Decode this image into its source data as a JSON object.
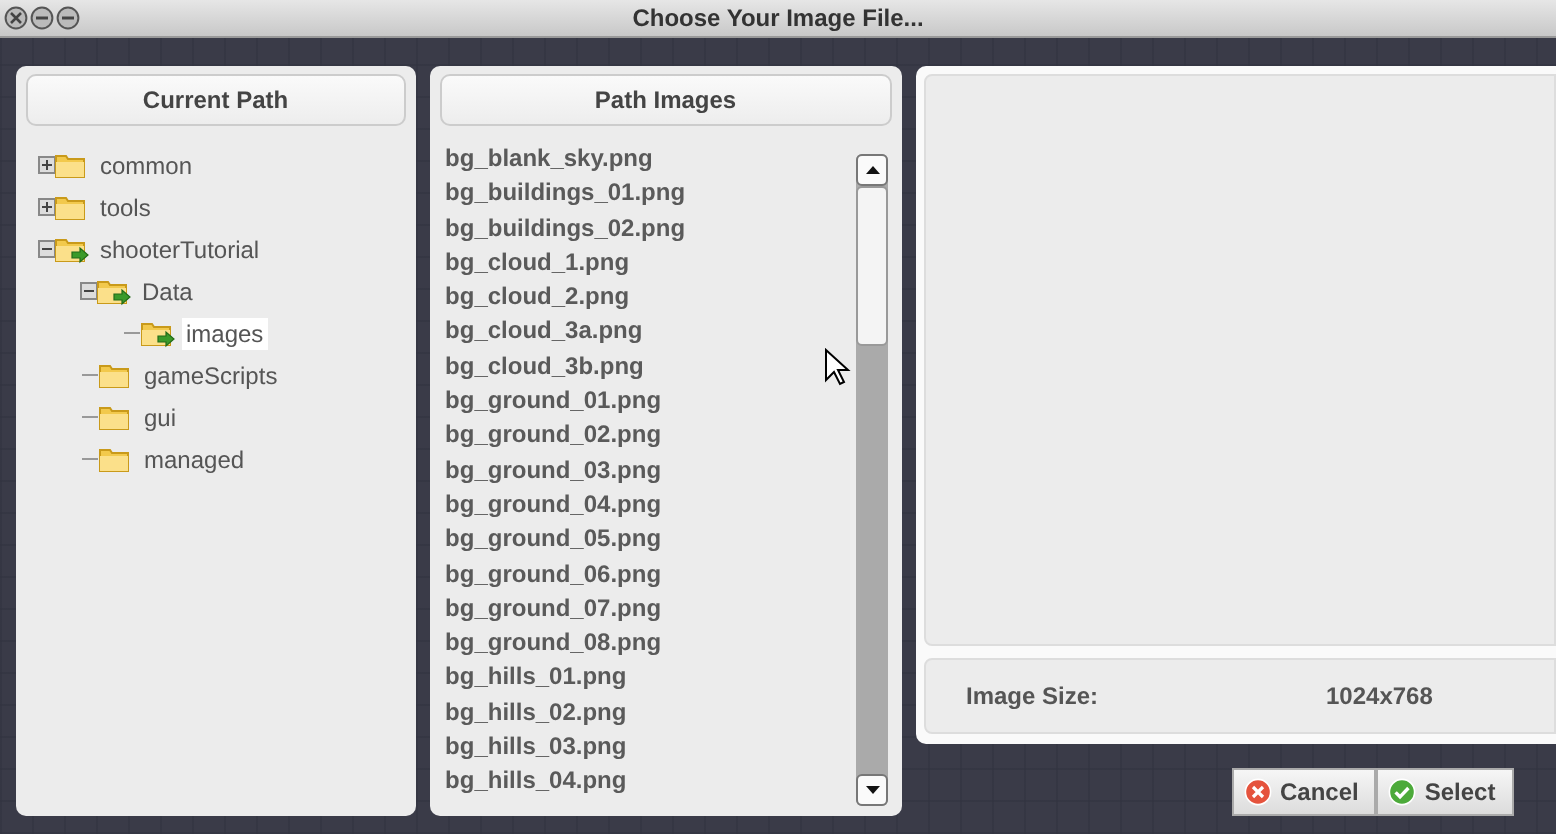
{
  "window": {
    "title": "Choose Your Image File..."
  },
  "current_path": {
    "heading": "Current Path",
    "tree": [
      {
        "label": "common",
        "expanded": false,
        "on_path": false,
        "selected": false
      },
      {
        "label": "tools",
        "expanded": false,
        "on_path": false,
        "selected": false
      },
      {
        "label": "shooterTutorial",
        "expanded": true,
        "on_path": true,
        "selected": false,
        "children": [
          {
            "label": "Data",
            "expanded": true,
            "on_path": true,
            "selected": false,
            "children": [
              {
                "label": "images",
                "on_path": true,
                "selected": true
              }
            ]
          },
          {
            "label": "gameScripts",
            "on_path": false,
            "selected": false
          },
          {
            "label": "gui",
            "on_path": false,
            "selected": false
          },
          {
            "label": "managed",
            "on_path": false,
            "selected": false
          }
        ]
      }
    ]
  },
  "path_images": {
    "heading": "Path Images",
    "files": [
      "bg_blank_sky.png",
      "bg_buildings_01.png",
      "bg_buildings_02.png",
      "bg_cloud_1.png",
      "bg_cloud_2.png",
      "bg_cloud_3a.png",
      "bg_cloud_3b.png",
      "bg_ground_01.png",
      "bg_ground_02.png",
      "bg_ground_03.png",
      "bg_ground_04.png",
      "bg_ground_05.png",
      "bg_ground_06.png",
      "bg_ground_07.png",
      "bg_ground_08.png",
      "bg_hills_01.png",
      "bg_hills_02.png",
      "bg_hills_03.png",
      "bg_hills_04.png"
    ]
  },
  "preview": {
    "size_label": "Image Size:",
    "size_value": "1024x768"
  },
  "buttons": [
    {
      "label": "Cancel",
      "kind": "cancel"
    },
    {
      "label": "Select",
      "kind": "select"
    }
  ]
}
